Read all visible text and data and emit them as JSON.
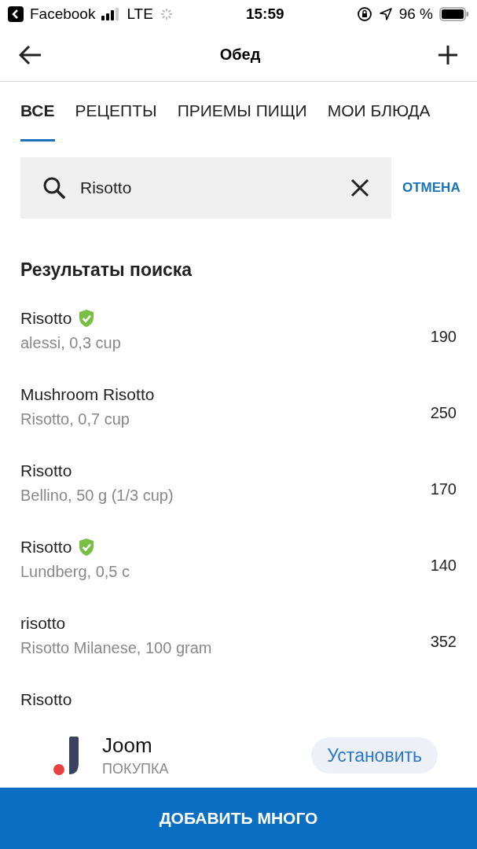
{
  "status_bar": {
    "back_app": "Facebook",
    "network": "LTE",
    "time": "15:59",
    "battery": "96 %"
  },
  "header": {
    "title": "Обед"
  },
  "tabs": [
    {
      "label": "ВСЕ",
      "selected": true
    },
    {
      "label": "РЕЦЕПТЫ",
      "selected": false
    },
    {
      "label": "ПРИЕМЫ ПИЩИ",
      "selected": false
    },
    {
      "label": "МОИ БЛЮДА",
      "selected": false
    }
  ],
  "search": {
    "value": "Risotto",
    "cancel": "ОТМЕНА"
  },
  "results": {
    "title": "Результаты поиска",
    "items": [
      {
        "name": "Risotto",
        "verified": true,
        "detail": "alessi, 0,3 cup",
        "calories": "190"
      },
      {
        "name": "Mushroom Risotto",
        "verified": false,
        "detail": "Risotto, 0,7 cup",
        "calories": "250"
      },
      {
        "name": "Risotto",
        "verified": false,
        "detail": "Bellino, 50 g (1/3 cup)",
        "calories": "170"
      },
      {
        "name": "Risotto",
        "verified": true,
        "detail": "Lundberg, 0,5 c",
        "calories": "140"
      },
      {
        "name": "risotto",
        "verified": false,
        "detail": "Risotto Milanese, 100 gram",
        "calories": "352"
      },
      {
        "name": "Risotto",
        "verified": false
      }
    ]
  },
  "ad": {
    "app": "Joom",
    "category": "ПОКУПКА",
    "button": "Установить"
  },
  "bottom_button": "ДОБАВИТЬ МНОГО"
}
